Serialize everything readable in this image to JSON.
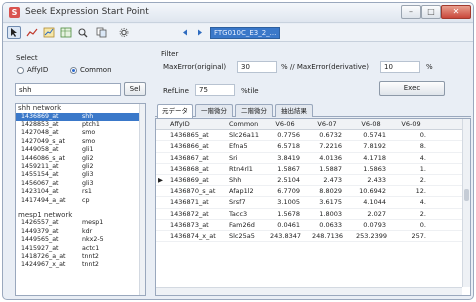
{
  "window": {
    "title": "Seek Expression Start Point",
    "minimize": "–",
    "maximize": "□",
    "close": "✕"
  },
  "toolbar": {
    "combo_value": "FTG010C_E3_2_..."
  },
  "select": {
    "label": "Select",
    "radio_affy": "AffyID",
    "radio_common": "Common",
    "search_value": "shh",
    "sel_button": "Sel"
  },
  "tree": {
    "groups": [
      {
        "name": "shh network",
        "items": [
          {
            "id": "1436869_at",
            "sym": "shh"
          },
          {
            "id": "1428853_at",
            "sym": "ptch1"
          },
          {
            "id": "1427048_at",
            "sym": "smo"
          },
          {
            "id": "1427049_s_at",
            "sym": "smo"
          },
          {
            "id": "1449058_at",
            "sym": "gli1"
          },
          {
            "id": "1446086_s_at",
            "sym": "gli2"
          },
          {
            "id": "1459211_at",
            "sym": "gli2"
          },
          {
            "id": "1455154_at",
            "sym": "gli3"
          },
          {
            "id": "1456067_at",
            "sym": "gli3"
          },
          {
            "id": "1423104_at",
            "sym": "rs1"
          },
          {
            "id": "1417494_a_at",
            "sym": "cp"
          }
        ]
      },
      {
        "name": "mesp1 network",
        "items": [
          {
            "id": "1426557_at",
            "sym": "mesp1"
          },
          {
            "id": "1449379_at",
            "sym": "kdr"
          },
          {
            "id": "1449565_at",
            "sym": "nkx2-5"
          },
          {
            "id": "1415927_at",
            "sym": "actc1"
          },
          {
            "id": "1418726_a_at",
            "sym": "tnnt2"
          },
          {
            "id": "1424967_x_at",
            "sym": "tnnt2"
          }
        ]
      }
    ]
  },
  "filter": {
    "label": "Filter",
    "max_error_label": "MaxError(original)",
    "max_error_value": "30",
    "mid_label": "% // MaxError(derivative)",
    "deriv_value": "10",
    "pct_label": "%",
    "refline_label": "RefLine",
    "refline_value": "75",
    "percentile_label": "%tile",
    "exec_label": "Exec"
  },
  "tabs": [
    "元データ",
    "一階微分",
    "二階微分",
    "抽出結果"
  ],
  "grid": {
    "headers": {
      "affy": "AffyID",
      "common": "Common",
      "v1": "V6-06",
      "v2": "V6-07",
      "v3": "V6-08",
      "v4": "V6-09"
    },
    "rows": [
      {
        "ptr": "",
        "affy": "1436865_at",
        "common": "Slc26a11",
        "v1": "0.7756",
        "v2": "0.6732",
        "v3": "0.5741",
        "v4": "0."
      },
      {
        "ptr": "",
        "affy": "1436866_at",
        "common": "Efna5",
        "v1": "6.5718",
        "v2": "7.2216",
        "v3": "7.8192",
        "v4": "8."
      },
      {
        "ptr": "",
        "affy": "1436867_at",
        "common": "Sri",
        "v1": "3.8419",
        "v2": "4.0136",
        "v3": "4.1718",
        "v4": "4."
      },
      {
        "ptr": "",
        "affy": "1436868_at",
        "common": "Rtn4rl1",
        "v1": "1.5867",
        "v2": "1.5887",
        "v3": "1.5863",
        "v4": "1."
      },
      {
        "ptr": "▶",
        "affy": "1436869_at",
        "common": "Shh",
        "v1": "2.5104",
        "v2": "2.473",
        "v3": "2.433",
        "v4": "2."
      },
      {
        "ptr": "",
        "affy": "1436870_s_at",
        "common": "Afap1l2",
        "v1": "6.7709",
        "v2": "8.8029",
        "v3": "10.6942",
        "v4": "12."
      },
      {
        "ptr": "",
        "affy": "1436871_at",
        "common": "Srsf7",
        "v1": "3.1005",
        "v2": "3.6175",
        "v3": "4.1044",
        "v4": "4."
      },
      {
        "ptr": "",
        "affy": "1436872_at",
        "common": "Tacc3",
        "v1": "1.5678",
        "v2": "1.8003",
        "v3": "2.027",
        "v4": "2."
      },
      {
        "ptr": "",
        "affy": "1436873_at",
        "common": "Fam26d",
        "v1": "0.0461",
        "v2": "0.0633",
        "v3": "0.0793",
        "v4": "0."
      },
      {
        "ptr": "",
        "affy": "1436874_x_at",
        "common": "Slc25a5",
        "v1": "243.8347",
        "v2": "248.7136",
        "v3": "253.2399",
        "v4": "257."
      }
    ]
  }
}
